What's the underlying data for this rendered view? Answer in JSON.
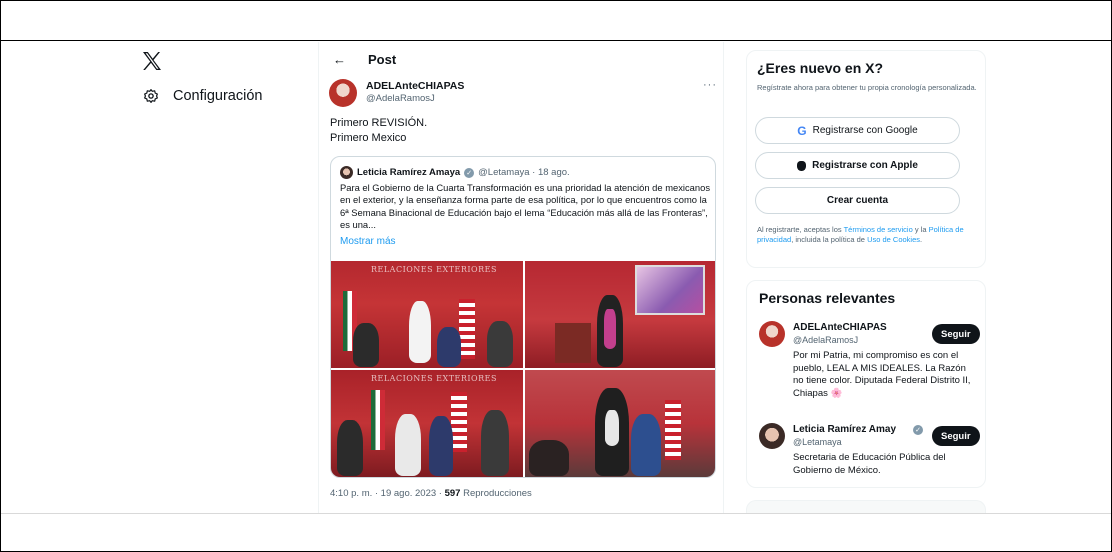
{
  "nav": {
    "config_label": "Configuración"
  },
  "post": {
    "header_title": "Post",
    "author_name": "ADELAnteCHIAPAS",
    "author_handle": "@AdelaRamosJ",
    "text_line1": "Primero REVISIÓN.",
    "text_line2": "Primero Mexico",
    "quote": {
      "name": "Leticia Ramírez Amaya",
      "handle_date": "@Letamaya · 18 ago.",
      "text": "Para el Gobierno de la Cuarta Transformación es una prioridad la atención de mexicanos en el exterior, y la enseñanza forma parte de esa política, por lo que encuentros como la 6ª Semana Binacional de Educación bajo el lema “Educación más allá de las Fronteras”, es una...",
      "show_more": "Mostrar más",
      "photo_banner": "RELACIONES EXTERIORES"
    },
    "timestamp": "4:10 p. m. · 19 ago. 2023 · ",
    "views_count": "597",
    "views_label": "Reproducciones"
  },
  "signup": {
    "title": "¿Eres nuevo en X?",
    "subtitle": "Regístrate ahora para obtener tu propia cronología personalizada.",
    "google_label": "Registrarse con Google",
    "apple_label": "Registrarse con Apple",
    "create_label": "Crear cuenta",
    "legal_prefix": "Al registrarte, aceptas los ",
    "terms_link": "Términos de servicio",
    "legal_mid1": " y la ",
    "privacy_link": "Política de privacidad",
    "legal_mid2": ", incluida la política de ",
    "cookies_link": "Uso de Cookies",
    "legal_suffix": "."
  },
  "relevant": {
    "title": "Personas relevantes",
    "people": [
      {
        "name": "ADELAnteCHIAPAS",
        "handle": "@AdelaRamosJ",
        "bio": "Por mi Patria, mi compromiso es con el pueblo, LEAL A MIS IDEALES. La Razón no tiene color. Diputada Federal Distrito II, Chiapas 🌸",
        "follow": "Seguir"
      },
      {
        "name": "Leticia Ramírez Amay",
        "handle": "@Letamaya",
        "bio": "Secretaria de Educación Pública del Gobierno de México.",
        "follow": "Seguir"
      }
    ]
  },
  "icons": {
    "logo": "x-logo-icon",
    "settings": "gear-icon",
    "back": "arrow-left-icon",
    "more": "more-dots-icon",
    "verified": "verified-badge-icon",
    "google": "google-icon",
    "apple": "apple-icon"
  },
  "colors": {
    "accent": "#1d9bf0",
    "text": "#0f1419",
    "muted": "#536471",
    "follow_bg": "#0f1419"
  }
}
